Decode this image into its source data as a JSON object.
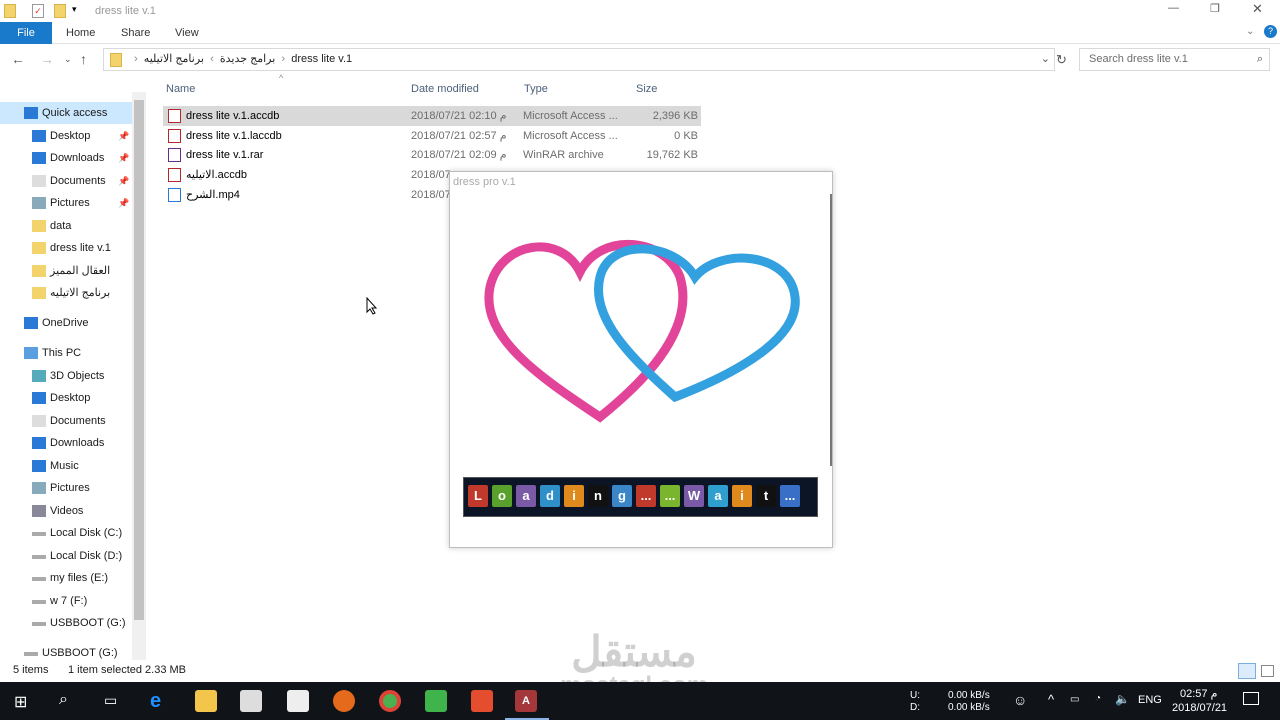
{
  "window": {
    "title": "dress lite v.1"
  },
  "ribbon": {
    "tabs": [
      "File",
      "Home",
      "Share",
      "View"
    ]
  },
  "address": {
    "path": [
      "برامج جديدة",
      "برنامج الاتيليه",
      "dress lite v.1"
    ],
    "search_placeholder": "Search dress lite v.1"
  },
  "sidebar": {
    "items": [
      {
        "label": "Quick access",
        "icon": "star-icon"
      },
      {
        "label": "Desktop",
        "icon": "desktop-icon",
        "pinned": true
      },
      {
        "label": "Downloads",
        "icon": "download-icon",
        "pinned": true
      },
      {
        "label": "Documents",
        "icon": "documents-icon",
        "pinned": true
      },
      {
        "label": "Pictures",
        "icon": "pictures-icon",
        "pinned": true
      },
      {
        "label": "data",
        "icon": "folder-icon"
      },
      {
        "label": "dress lite v.1",
        "icon": "folder-icon"
      },
      {
        "label": "العقال المميز",
        "icon": "folder-icon"
      },
      {
        "label": "برنامج الاتيليه",
        "icon": "folder-icon"
      },
      {
        "label": "OneDrive",
        "icon": "cloud-icon"
      },
      {
        "label": "This PC",
        "icon": "pc-icon"
      },
      {
        "label": "3D Objects",
        "icon": "cube-icon"
      },
      {
        "label": "Desktop",
        "icon": "desktop-icon"
      },
      {
        "label": "Documents",
        "icon": "documents-icon"
      },
      {
        "label": "Downloads",
        "icon": "download-icon"
      },
      {
        "label": "Music",
        "icon": "music-icon"
      },
      {
        "label": "Pictures",
        "icon": "pictures-icon"
      },
      {
        "label": "Videos",
        "icon": "videos-icon"
      },
      {
        "label": "Local Disk (C:)",
        "icon": "drive-icon"
      },
      {
        "label": "Local Disk (D:)",
        "icon": "drive-icon"
      },
      {
        "label": "my files (E:)",
        "icon": "drive-icon"
      },
      {
        "label": "w 7 (F:)",
        "icon": "drive-icon"
      },
      {
        "label": "USBBOOT (G:)",
        "icon": "drive-icon"
      },
      {
        "label": "USBBOOT (G:)",
        "icon": "usb-icon"
      }
    ]
  },
  "columns": [
    "Name",
    "Date modified",
    "Type",
    "Size"
  ],
  "files": [
    {
      "name": "dress lite v.1.accdb",
      "date": "2018/07/21 م 02:10",
      "type": "Microsoft Access ...",
      "size": "2,396 KB",
      "selected": true
    },
    {
      "name": "dress lite v.1.laccdb",
      "date": "2018/07/21 م 02:57",
      "type": "Microsoft Access ...",
      "size": "0 KB"
    },
    {
      "name": "dress lite v.1.rar",
      "date": "2018/07/21 م 02:09",
      "type": "WinRAR archive",
      "size": "19,762 KB"
    },
    {
      "name": "الاتيليه.accdb",
      "date": "2018/07",
      "type": "",
      "size": ""
    },
    {
      "name": "الشرح.mp4",
      "date": "2018/07",
      "type": "",
      "size": ""
    }
  ],
  "splash": {
    "title": "dress pro v.1",
    "loading": [
      "L",
      "o",
      "a",
      "d",
      "i",
      "n",
      "g",
      "...",
      "...",
      "W",
      "a",
      "i",
      "t",
      "..."
    ],
    "colors": [
      "#c0392b",
      "#5aa02c",
      "#7a5aa6",
      "#2f8fc8",
      "#e08a1e",
      "#111111",
      "#3a86c8",
      "#c0392b",
      "#7ab52e",
      "#7a5aa6",
      "#2f9fd0",
      "#e08a1e",
      "#111111",
      "#3a6fc8"
    ]
  },
  "status": {
    "count": "5 items",
    "selection": "1 item selected  2.33 MB"
  },
  "taskbar": {
    "up_label": "U:",
    "down_label": "D:",
    "up": "0.00 kB/s",
    "down": "0.00 kB/s",
    "lang": "ENG",
    "time": "02:57 م",
    "date": "2018/07/21"
  },
  "watermark": {
    "arabic": "مستقل",
    "latin": "mostaql.com"
  }
}
